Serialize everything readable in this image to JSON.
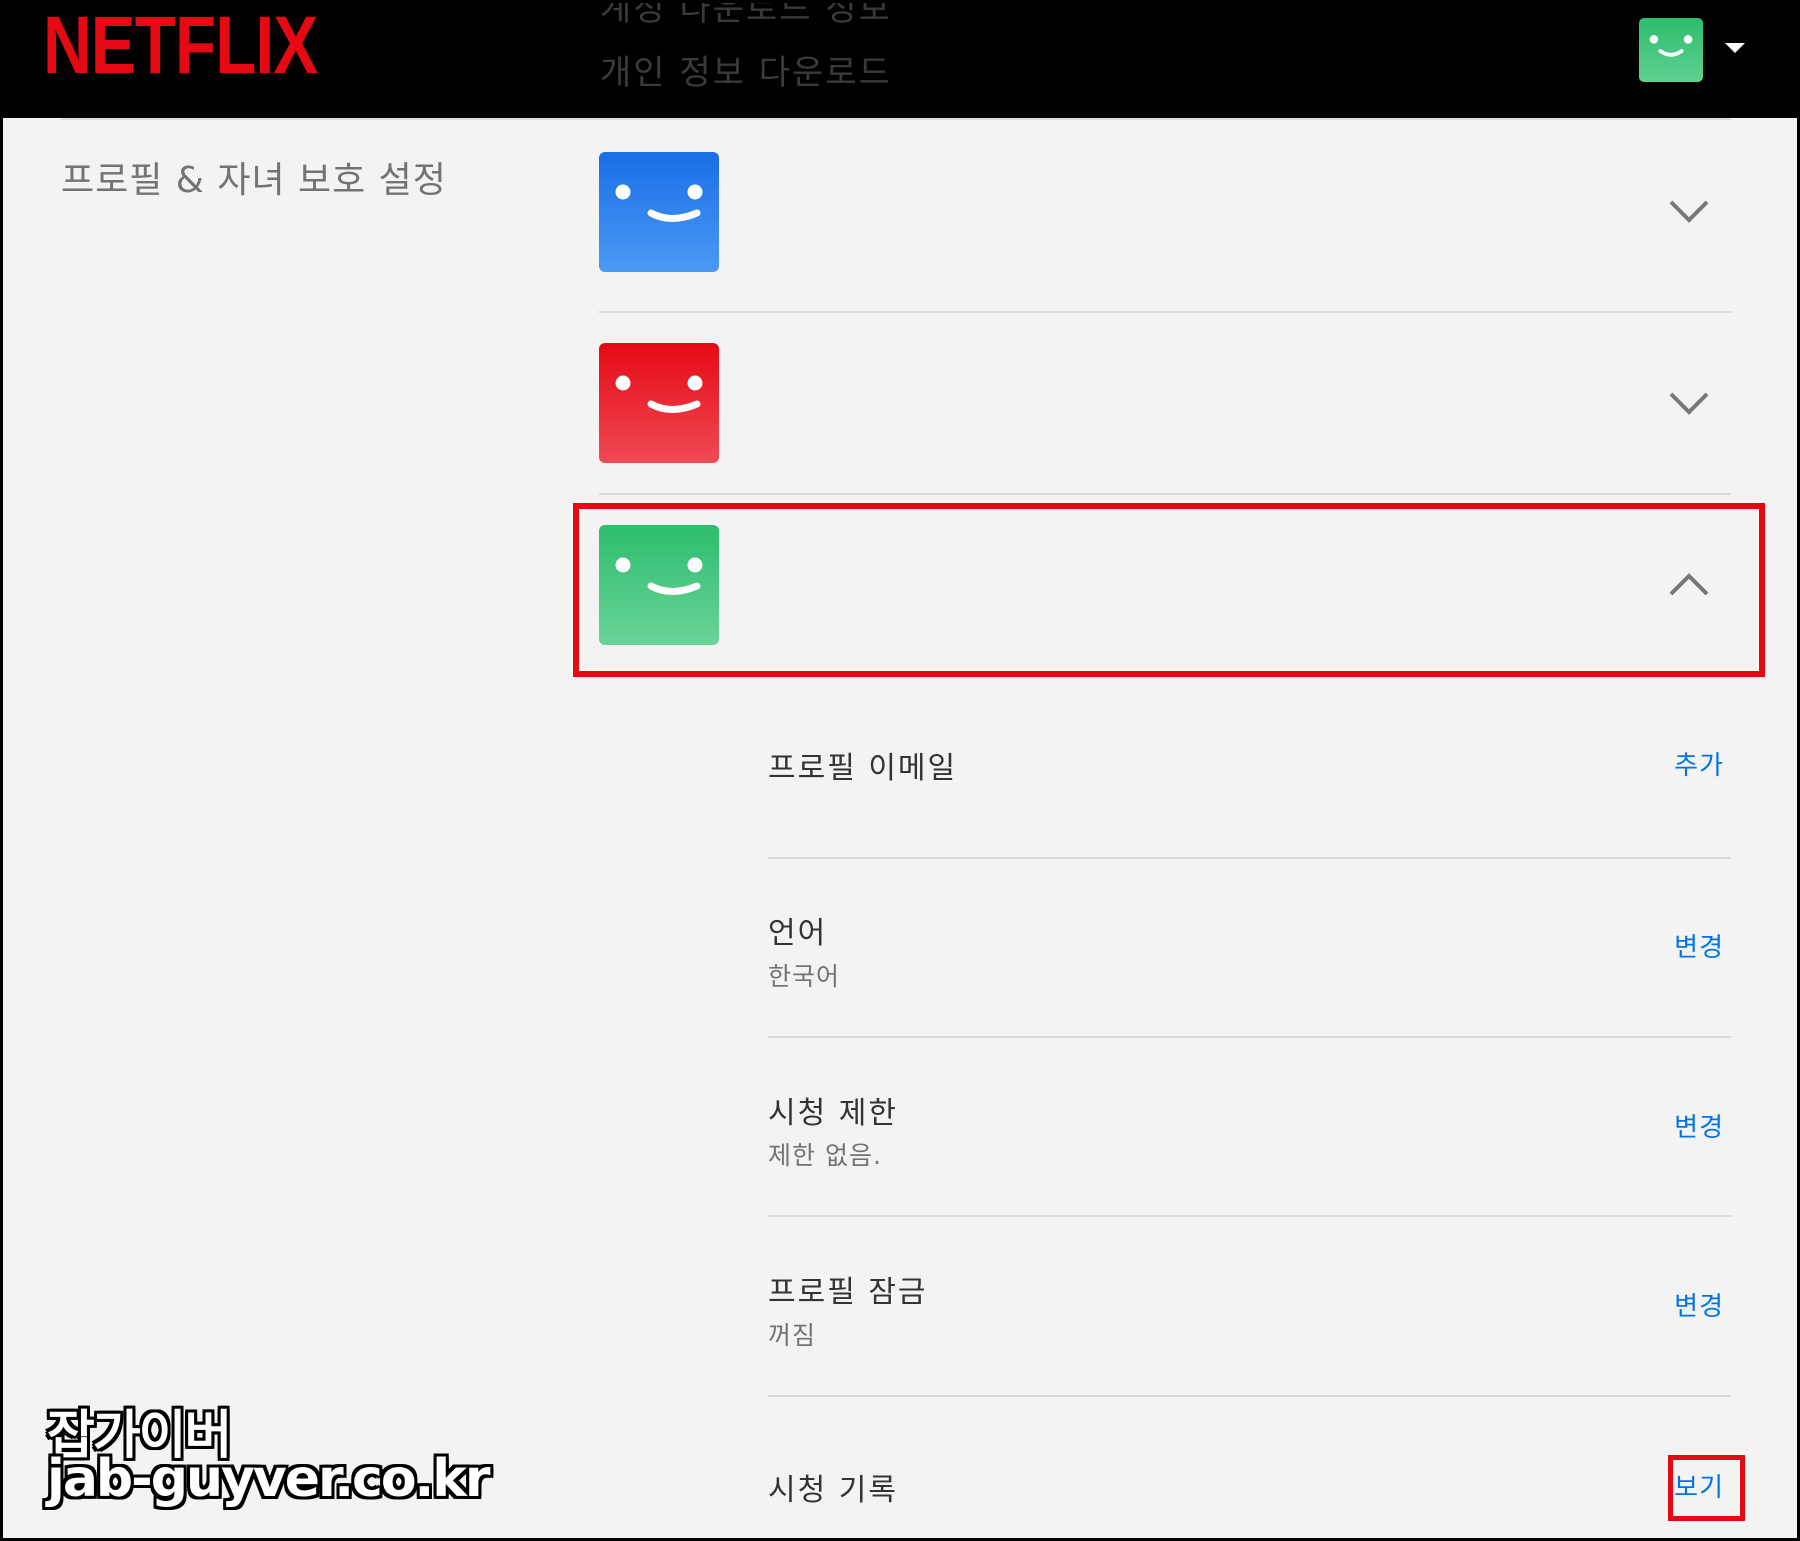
{
  "header": {
    "logo": "NETFLIX",
    "ghost_line_1": "계정 다운로드 정보",
    "ghost_line_2": "개인 정보 다운로드"
  },
  "sidebar": {
    "section_title": "프로필 & 자녀 보호 설정"
  },
  "profiles": [
    {
      "color": "#1a6ee6",
      "expanded": false,
      "icon": "chevron-down-icon"
    },
    {
      "color": "#e50914",
      "expanded": false,
      "icon": "chevron-down-icon"
    },
    {
      "color": "#2dbd6e",
      "expanded": true,
      "icon": "chevron-up-icon"
    }
  ],
  "settings": [
    {
      "label": "프로필 이메일",
      "value": "",
      "action": "추가"
    },
    {
      "label": "언어",
      "value": "한국어",
      "action": "변경"
    },
    {
      "label": "시청 제한",
      "value": "제한 없음.",
      "action": "변경"
    },
    {
      "label": "프로필 잠금",
      "value": "꺼짐",
      "action": "변경"
    },
    {
      "label": "시청 기록",
      "value": "",
      "action": "보기"
    }
  ],
  "watermark": {
    "line1": "잡가이버",
    "line2": "jab-guyver.co.kr"
  },
  "colors": {
    "brand_red": "#e50914",
    "link_blue": "#0073e6",
    "highlight_red": "#e50914"
  }
}
